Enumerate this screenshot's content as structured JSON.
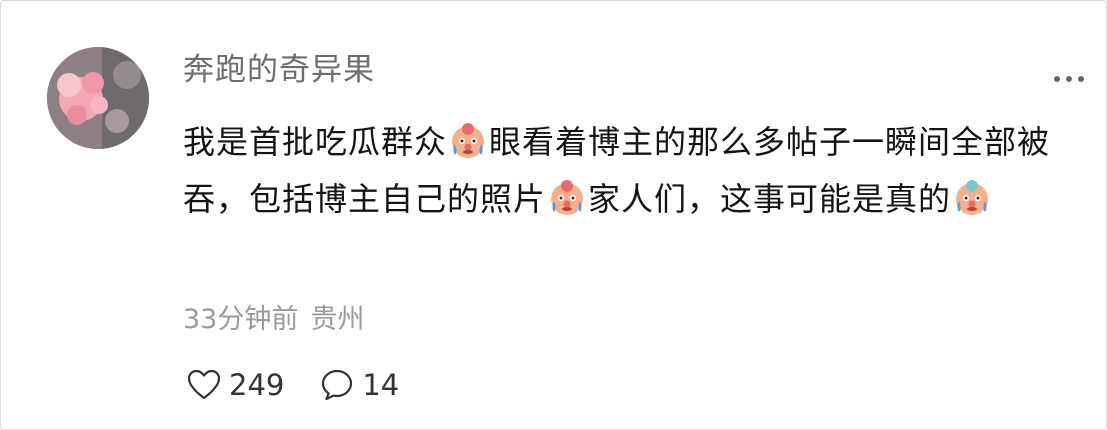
{
  "comment": {
    "username": "奔跑的奇异果",
    "text_parts": {
      "p1": "我是首批吃瓜群众",
      "p2": "眼看着博主的那么多帖子一瞬间全部被吞，包括博主自己的照片",
      "p3": "家人们，这事可能是真的"
    },
    "emojis": [
      "crying-clown-emoji",
      "crying-clown-emoji",
      "crying-clown-emoji"
    ],
    "time": "33分钟前",
    "location": "贵州",
    "likes": "249",
    "replies": "14"
  },
  "icons": {
    "more": "more-dots-icon",
    "like": "heart-icon",
    "reply": "comment-bubble-icon"
  },
  "colors": {
    "username": "#6d6d6d",
    "text": "#141414",
    "meta": "#9a9a9a",
    "emoji_face": "#f3b08a",
    "emoji_cheeks": "#e86a6a",
    "emoji_tears": "#4d9be8"
  }
}
